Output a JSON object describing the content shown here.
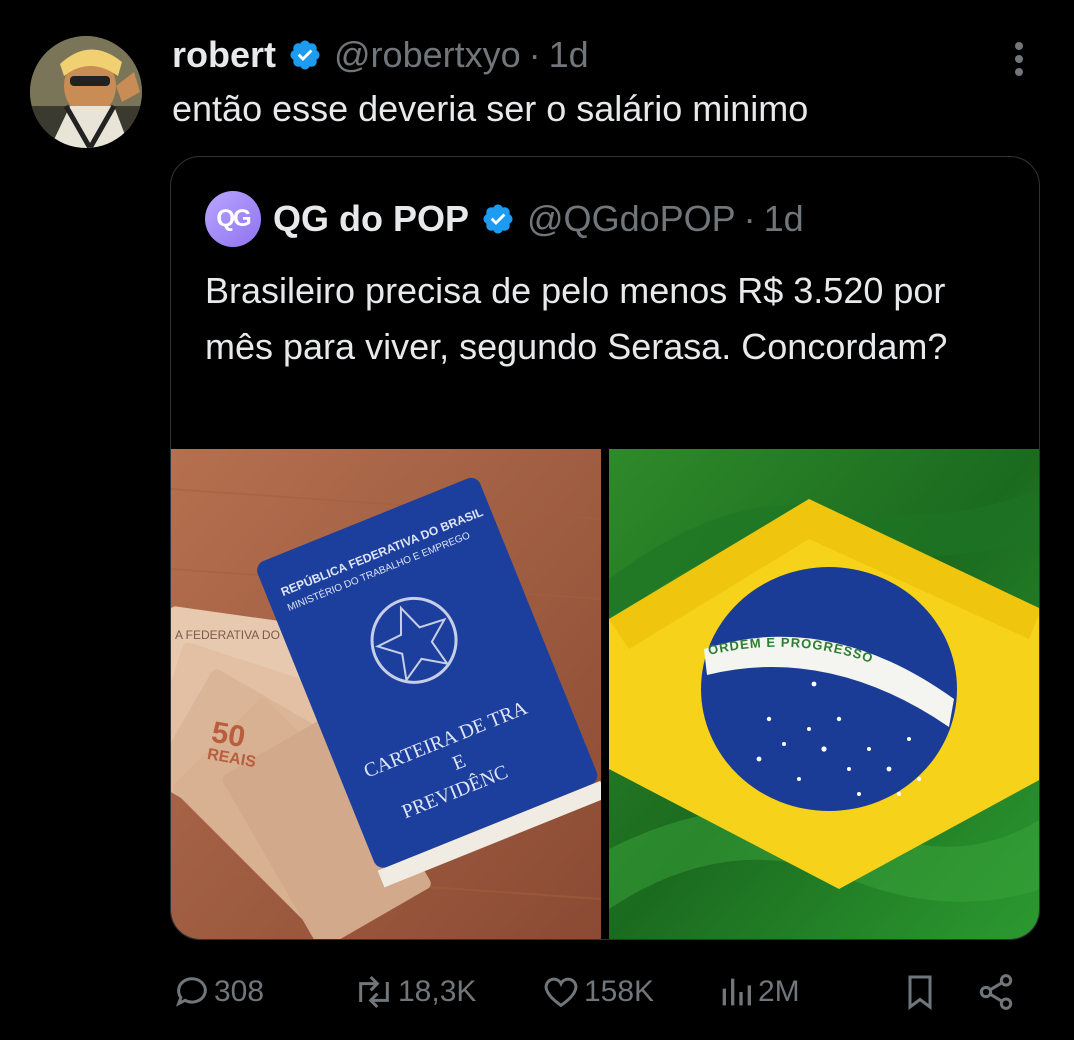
{
  "tweet": {
    "author_name": "robert",
    "handle": "@robertxyo",
    "separator": "·",
    "time": "1d",
    "text": "então esse deveria ser o salário minimo"
  },
  "quote": {
    "author_name": "QG do POP",
    "avatar_text": "QG",
    "handle": "@QGdoPOP",
    "separator": "·",
    "time": "1d",
    "text": "Brasileiro precisa de pelo menos R$ 3.520 por mês para viver, segundo Serasa. Concordam?",
    "image_left": {
      "card_title_top": "REPÚBLICA FEDERATIVA DO BRASIL",
      "card_title_sub": "MINISTÉRIO DO TRABALHO E EMPREGO",
      "card_label_1": "CARTEIRA DE TRA",
      "card_label_2": "E",
      "card_label_3": "PREVIDÊNC",
      "note_value": "50",
      "note_currency": "REAIS",
      "note_header": "A FEDERATIVA DO BR"
    },
    "image_right": {
      "flag_motto": "ORDEM E PROGRESSO"
    }
  },
  "actions": {
    "replies": "308",
    "reposts": "18,3K",
    "likes": "158K",
    "views": "2M"
  },
  "colors": {
    "background": "#000000",
    "text": "#e7e9ea",
    "muted": "#71767b",
    "verified": "#1d9bf0",
    "border": "#2f3336"
  }
}
